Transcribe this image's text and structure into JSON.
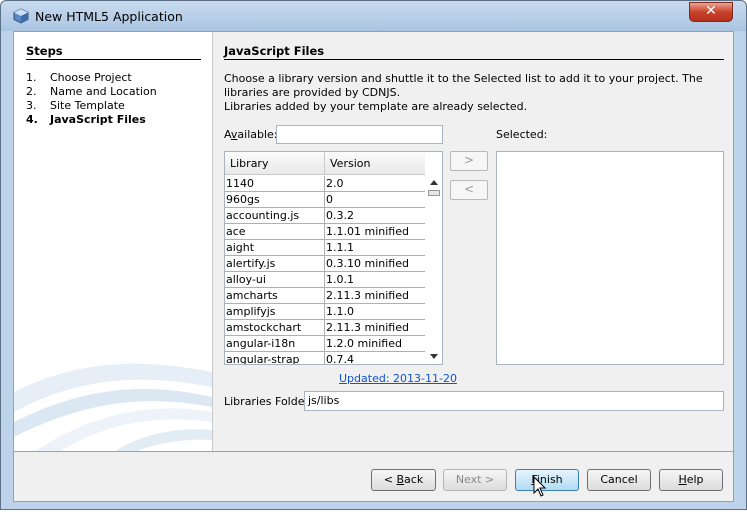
{
  "window": {
    "title": "New HTML5 Application",
    "close_glyph": "✕"
  },
  "steps": {
    "title": "Steps",
    "items": [
      {
        "num": "1.",
        "label": "Choose Project"
      },
      {
        "num": "2.",
        "label": "Name and Location"
      },
      {
        "num": "3.",
        "label": "Site Template"
      },
      {
        "num": "4.",
        "label": "JavaScript Files"
      }
    ]
  },
  "main": {
    "title": "JavaScript Files",
    "description_line1": "Choose a library version and shuttle it to the Selected list to add it to your project. The libraries are provided by CDNJS.",
    "description_line2": "Libraries added by your template are already selected.",
    "available_label_pre": "A",
    "available_label_mnemonic": "v",
    "available_label_post": "ailable:",
    "available_value": "",
    "selected_label": "Selected:",
    "table": {
      "columns": [
        "Library",
        "Version"
      ],
      "rows": [
        [
          "1140",
          "2.0"
        ],
        [
          "960gs",
          "0"
        ],
        [
          "accounting.js",
          "0.3.2"
        ],
        [
          "ace",
          "1.1.01 minified"
        ],
        [
          "aight",
          "1.1.1"
        ],
        [
          "alertify.js",
          "0.3.10 minified"
        ],
        [
          "alloy-ui",
          "1.0.1"
        ],
        [
          "amcharts",
          "2.11.3 minified"
        ],
        [
          "amplifyjs",
          "1.1.0"
        ],
        [
          "amstockchart",
          "2.11.3 minified"
        ],
        [
          "angular-i18n",
          "1.2.0 minified"
        ],
        [
          "angular-strap",
          "0.7.4"
        ]
      ]
    },
    "shuttle_add": ">",
    "shuttle_remove": "<",
    "updated_link": "Updated: 2013-11-20",
    "folder_label": "Libraries Folder:",
    "folder_value": "js/libs"
  },
  "buttons": {
    "back_pre": "< ",
    "back_mnemonic": "B",
    "back_post": "ack",
    "next": "Next >",
    "finish_mnemonic": "F",
    "finish_post": "inish",
    "cancel": "Cancel",
    "help_mnemonic": "H",
    "help_post": "elp"
  },
  "colors": {
    "link": "#1155cc",
    "title_bar": "#aac5e2",
    "close_button": "#c9412b",
    "default_button": "#b1dbf4"
  }
}
